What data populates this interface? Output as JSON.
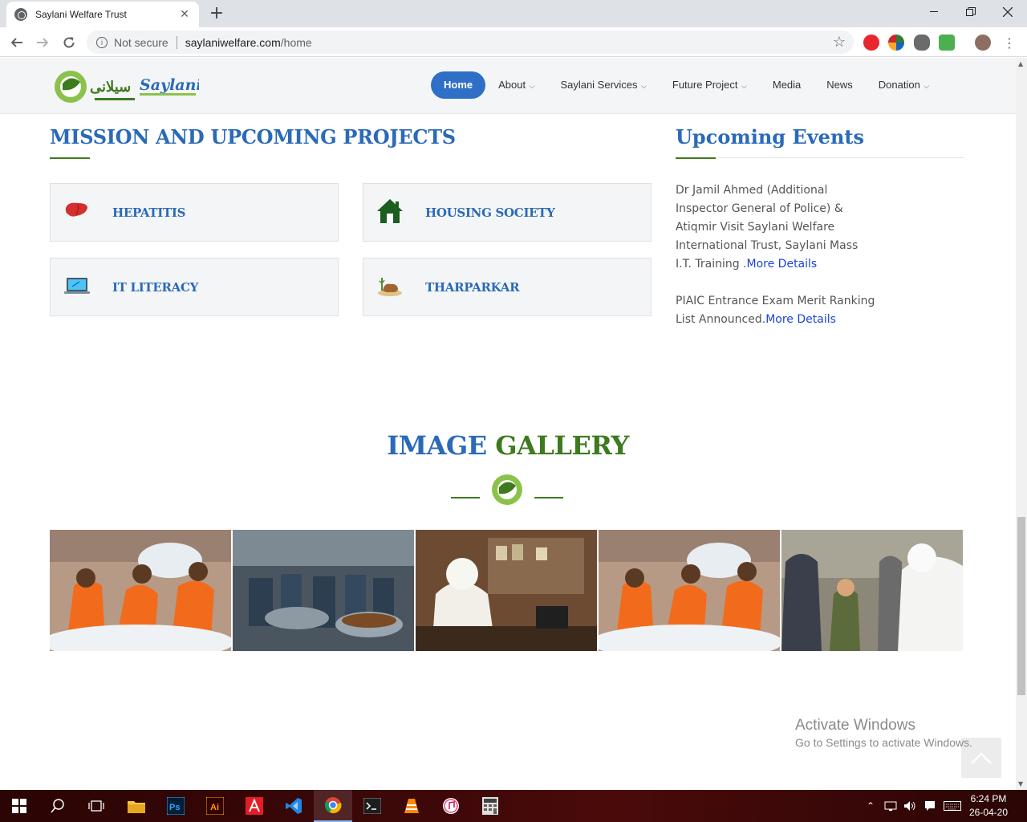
{
  "browser": {
    "tab_title": "Saylani Welfare Trust",
    "security_label": "Not secure",
    "url_host": "saylaniwelfare.com",
    "url_path": "/home"
  },
  "site": {
    "logo_alt": "Saylani",
    "nav": [
      {
        "label": "Home",
        "dropdown": false,
        "active": true
      },
      {
        "label": "About",
        "dropdown": true
      },
      {
        "label": "Saylani Services",
        "dropdown": true
      },
      {
        "label": "Future Project",
        "dropdown": true
      },
      {
        "label": "Media",
        "dropdown": false
      },
      {
        "label": "News",
        "dropdown": false
      },
      {
        "label": "Donation",
        "dropdown": true
      }
    ]
  },
  "mission": {
    "title": "MISSION AND UPCOMING PROJECTS",
    "cards": [
      {
        "label": "HEPATITIS",
        "icon": "liver-icon"
      },
      {
        "label": "HOUSING SOCIETY",
        "icon": "house-icon"
      },
      {
        "label": "IT LITERACY",
        "icon": "laptop-icon"
      },
      {
        "label": "THARPARKAR",
        "icon": "desert-icon"
      }
    ]
  },
  "events": {
    "title": "Upcoming Events",
    "items": [
      {
        "text": "Dr Jamil Ahmed (Additional Inspector General of Police) & Atiqmir Visit Saylani Welfare International Trust, Saylani Mass I.T. Training .",
        "link": "More Details"
      },
      {
        "text": "PIAIC Entrance Exam Merit Ranking List Announced.",
        "link": "More Details"
      }
    ]
  },
  "gallery": {
    "title_part1": "IMAGE",
    "title_part2": "GALLERY"
  },
  "watermark": {
    "line1": "Activate Windows",
    "line2": "Go to Settings to activate Windows."
  },
  "taskbar": {
    "time": "6:24 PM",
    "date": "26-04-20"
  },
  "colors": {
    "brand_blue": "#2a6ab8",
    "brand_green": "#3e7a1e",
    "link": "#1a44d8",
    "nav_active": "#2f6fc6"
  }
}
